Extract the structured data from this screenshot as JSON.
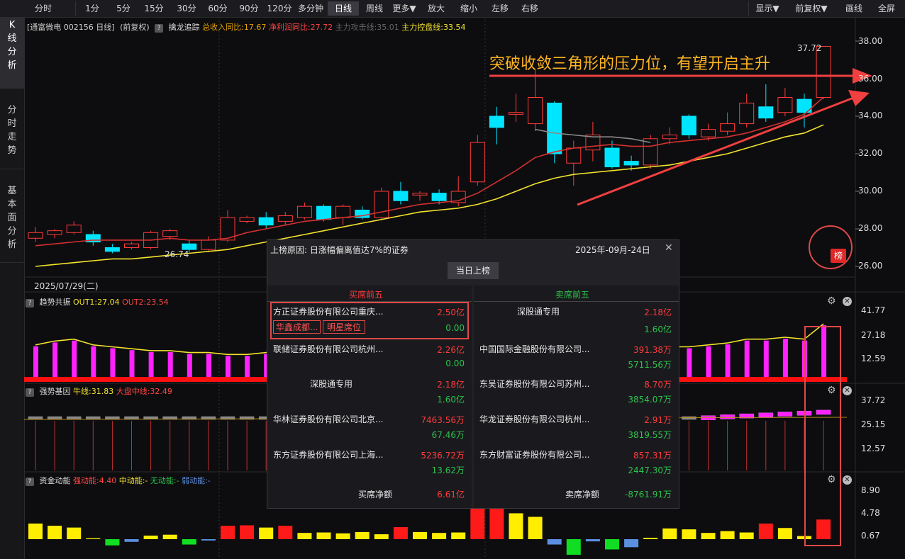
{
  "toolbar": {
    "periods": [
      "分时",
      "1分",
      "5分",
      "15分",
      "30分",
      "60分",
      "90分",
      "120分",
      "多分钟",
      "日线",
      "周线",
      "更多▼",
      "放大",
      "缩小",
      "左移",
      "右移"
    ],
    "active_period": "日线",
    "right": [
      "显示▼",
      "前复权▼",
      "画线",
      "全屏"
    ]
  },
  "sidebar": {
    "tabs": [
      "K线分析",
      "分时走势",
      "基本面分析"
    ]
  },
  "main_header": {
    "stock": "[通富微电 002156 日线]",
    "adjust": "(前复权)",
    "indicator": "擒龙追踪",
    "rev_growth": "总收入同比:17.67",
    "profit_growth": "净利润同比:27.72",
    "attack_line": "主力攻击线:35.01",
    "control_line": "主力控盘线:33.54"
  },
  "annotation": "突破收敛三角形的压力位，有望开启主升",
  "price_axis": [
    "38.00",
    "36.00",
    "34.00",
    "32.00",
    "30.00",
    "28.00",
    "26.00"
  ],
  "high_label": "37.72",
  "low_label": "26.74",
  "date_label": "2025/07/29(二)",
  "bang_badge": "榜",
  "panel1": {
    "name": "趋势共振",
    "out1": "OUT1:27.04",
    "out2": "OUT2:23.54",
    "axis": [
      "41.77",
      "27.18",
      "12.59"
    ]
  },
  "panel2": {
    "name": "强势基因",
    "bull": "牛线:31.83",
    "market": "大盘中线:32.49",
    "axis": [
      "37.72",
      "25.15",
      "12.57"
    ]
  },
  "panel3": {
    "name": "资金动能",
    "strong": "强动能:4.40",
    "mid": "中动能:-",
    "none": "无动能:-",
    "weak": "弱动能:-",
    "axis": [
      "8.90",
      "4.78",
      "0.67"
    ]
  },
  "popup": {
    "reason": "上榜原因: 日涨幅偏离值达7%的证券",
    "date": "2025年-09月-24日",
    "button": "当日上榜",
    "buy_header": "买席前五",
    "sell_header": "卖席前五",
    "buy": [
      {
        "name": "方正证券股份有限公司重庆...",
        "amount": "2.50亿",
        "sell": "0.00",
        "tags": [
          "华鑫成都...",
          "明星席位"
        ]
      },
      {
        "name": "联储证券股份有限公司杭州...",
        "amount": "2.26亿",
        "sell": "0.00"
      },
      {
        "name": "深股通专用",
        "amount": "2.18亿",
        "sell": "1.60亿"
      },
      {
        "name": "华林证券股份有限公司北京...",
        "amount": "7463.56万",
        "sell": "67.46万"
      },
      {
        "name": "东方证券股份有限公司上海...",
        "amount": "5236.72万",
        "sell": "13.62万"
      }
    ],
    "sell": [
      {
        "name": "深股通专用",
        "amount": "2.18亿",
        "buy": "1.60亿"
      },
      {
        "name": "中国国际金融股份有限公司...",
        "amount": "391.38万",
        "buy": "5711.56万"
      },
      {
        "name": "东吴证券股份有限公司苏州...",
        "amount": "8.70万",
        "buy": "3854.07万"
      },
      {
        "name": "华龙证券股份有限公司杭州...",
        "amount": "2.91万",
        "buy": "3819.55万"
      },
      {
        "name": "东方财富证券股份有限公司...",
        "amount": "857.31万",
        "buy": "2447.30万"
      }
    ],
    "buy_net_label": "买席净额",
    "buy_net": "6.61亿",
    "sell_net_label": "卖席净额",
    "sell_net": "-8761.91万"
  },
  "chart_data": {
    "type": "candlestick",
    "ylim": [
      25.5,
      38.3
    ],
    "candles": [
      [
        27.5,
        27.8,
        28.1,
        27.3
      ],
      [
        27.7,
        27.9,
        28.0,
        27.5
      ],
      [
        27.8,
        28.2,
        28.4,
        27.7
      ],
      [
        27.7,
        27.3,
        27.9,
        27.1
      ],
      [
        27.0,
        26.8,
        27.2,
        26.7
      ],
      [
        27.0,
        27.2,
        27.3,
        26.9
      ],
      [
        27.0,
        27.8,
        27.9,
        26.9
      ],
      [
        27.6,
        27.9,
        28.0,
        27.4
      ],
      [
        27.2,
        26.9,
        27.4,
        26.74
      ],
      [
        26.9,
        27.4,
        27.6,
        26.8
      ],
      [
        27.4,
        28.6,
        29.0,
        27.3
      ],
      [
        28.4,
        28.6,
        28.7,
        28.3
      ],
      [
        28.6,
        28.2,
        28.9,
        28.0
      ],
      [
        28.4,
        28.7,
        28.9,
        28.2
      ],
      [
        28.6,
        29.2,
        29.4,
        28.5
      ],
      [
        29.2,
        28.5,
        29.3,
        28.4
      ],
      [
        28.6,
        29.2,
        29.3,
        28.2
      ],
      [
        29.0,
        28.6,
        29.2,
        28.5
      ],
      [
        28.6,
        30.0,
        30.2,
        28.5
      ],
      [
        30.0,
        29.5,
        30.5,
        29.3
      ],
      [
        29.8,
        29.9,
        30.0,
        29.5
      ],
      [
        29.9,
        29.5,
        30.1,
        29.3
      ],
      [
        29.4,
        30.0,
        30.8,
        29.2
      ],
      [
        30.5,
        32.6,
        33.0,
        30.3
      ],
      [
        34.0,
        33.4,
        34.5,
        32.5
      ],
      [
        34.1,
        34.2,
        35.2,
        33.7
      ],
      [
        33.6,
        35.0,
        36.5,
        33.2
      ],
      [
        34.7,
        32.0,
        34.8,
        31.5
      ],
      [
        31.5,
        32.3,
        32.7,
        30.3
      ],
      [
        32.2,
        33.0,
        33.7,
        31.6
      ],
      [
        32.3,
        31.3,
        32.7,
        31.2
      ],
      [
        31.6,
        31.4,
        31.9,
        31.1
      ],
      [
        31.4,
        32.8,
        33.0,
        31.2
      ],
      [
        32.8,
        33.0,
        33.4,
        32.5
      ],
      [
        34.0,
        33.0,
        34.1,
        32.8
      ],
      [
        32.9,
        33.3,
        33.6,
        32.7
      ],
      [
        33.2,
        33.6,
        34.2,
        33.0
      ],
      [
        33.6,
        34.7,
        35.2,
        33.4
      ],
      [
        34.5,
        33.9,
        35.7,
        33.7
      ],
      [
        34.2,
        35.0,
        35.5,
        34.0
      ],
      [
        34.9,
        34.2,
        35.2,
        33.4
      ],
      [
        35.0,
        37.72,
        37.72,
        34.9
      ]
    ],
    "ma_red": [
      27.1,
      27.2,
      27.3,
      27.4,
      27.4,
      27.4,
      27.4,
      27.5,
      27.4,
      27.4,
      27.5,
      27.8,
      28.0,
      28.2,
      28.4,
      28.5,
      28.6,
      28.7,
      28.9,
      29.1,
      29.3,
      29.4,
      29.5,
      29.9,
      30.5,
      31.1,
      31.8,
      32.1,
      32.3,
      32.4,
      32.5,
      32.4,
      32.4,
      32.6,
      32.7,
      32.8,
      32.9,
      33.1,
      33.4,
      33.7,
      34.1,
      35.01
    ],
    "ma_yellow": [
      26.0,
      26.1,
      26.2,
      26.3,
      26.4,
      26.4,
      26.5,
      26.6,
      26.7,
      26.8,
      26.9,
      27.1,
      27.3,
      27.5,
      27.7,
      27.9,
      28.1,
      28.3,
      28.5,
      28.7,
      28.9,
      29.0,
      29.1,
      29.3,
      29.6,
      30.0,
      30.4,
      30.7,
      30.9,
      31.0,
      31.1,
      31.2,
      31.3,
      31.4,
      31.6,
      31.8,
      32.0,
      32.3,
      32.6,
      32.9,
      33.1,
      33.54
    ],
    "ma_gray": [
      null,
      null,
      null,
      null,
      null,
      null,
      null,
      null,
      null,
      null,
      null,
      null,
      null,
      null,
      null,
      null,
      null,
      null,
      null,
      null,
      null,
      null,
      null,
      null,
      null,
      null,
      33.3,
      33.1,
      33.0,
      32.9,
      32.9,
      32.8,
      32.6,
      null,
      null,
      null,
      null,
      null,
      null,
      null,
      null,
      null
    ],
    "panel1_bars": [
      16,
      18,
      19,
      16,
      15,
      14,
      13,
      13,
      12,
      12,
      11,
      11,
      12,
      12,
      12,
      12,
      12,
      12,
      12,
      12,
      12,
      12,
      12,
      12,
      12,
      12,
      12,
      12,
      12,
      12,
      12,
      12,
      12,
      15,
      15,
      16,
      17,
      19,
      19,
      20,
      19,
      27
    ],
    "panel3_bars": [
      3.5,
      3.0,
      2.6,
      0.2,
      -1.4,
      -0.6,
      0.8,
      1.0,
      -1.2,
      -0.3,
      3.0,
      3.1,
      2.6,
      3.0,
      1.4,
      1.5,
      1.3,
      1.6,
      1.1,
      2.7,
      1.6,
      1.4,
      1.5,
      7.2,
      7.2,
      5.8,
      5.0,
      -1.2,
      -3.5,
      -0.5,
      -2.3,
      -1.8,
      0.3,
      2.4,
      2.2,
      1.4,
      1.8,
      1.5,
      3.5,
      2.5,
      0.7,
      4.4
    ]
  }
}
